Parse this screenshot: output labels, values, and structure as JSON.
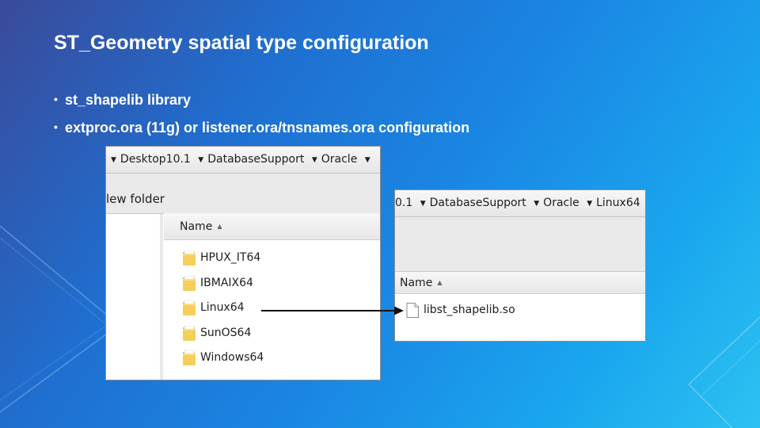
{
  "slide": {
    "title": "ST_Geometry spatial type configuration",
    "bullets": [
      "st_shapelib library",
      "extproc.ora (11g) or listener.ora/tnsnames.ora configuration"
    ]
  },
  "explorer_left": {
    "breadcrumbs": [
      "Desktop10.1",
      "DatabaseSupport",
      "Oracle"
    ],
    "toolbar_label": "lew folder",
    "column_header": "Name",
    "folders": [
      "HPUX_IT64",
      "IBMAIX64",
      "Linux64",
      "SunOS64",
      "Windows64"
    ]
  },
  "explorer_right": {
    "breadcrumbs": [
      "0.1",
      "DatabaseSupport",
      "Oracle",
      "Linux64"
    ],
    "column_header": "Name",
    "files": [
      "libst_shapelib.so"
    ]
  },
  "icons": {
    "bullet": "•",
    "breadcrumb_separator": "chevron-down-icon",
    "sort_indicator": "▲",
    "folder": "folder-icon",
    "file": "file-icon"
  },
  "colors": {
    "folder": "#f2c94c",
    "arrow": "#111111"
  }
}
